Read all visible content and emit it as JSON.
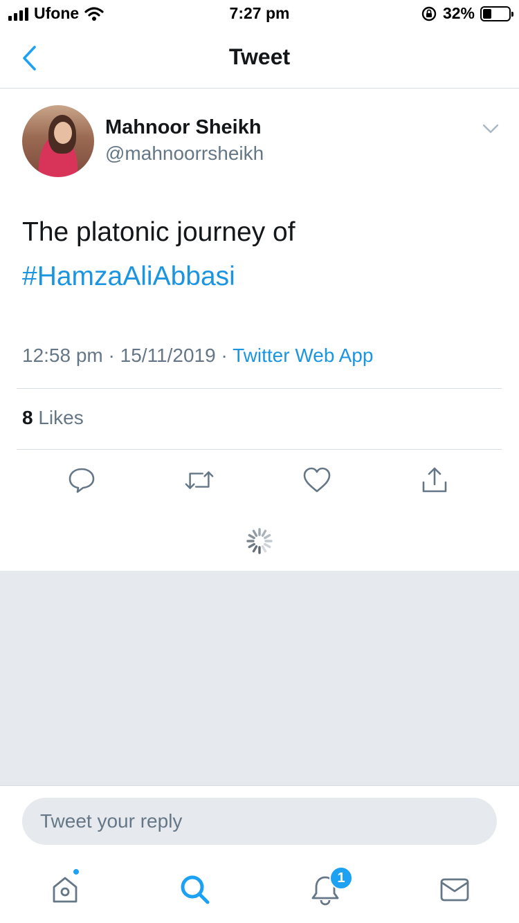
{
  "status_bar": {
    "carrier": "Ufone",
    "time": "7:27 pm",
    "battery_percent": "32%",
    "battery_level": 0.32,
    "icons": [
      "signal-icon",
      "wifi-icon",
      "orientation-lock-icon",
      "battery-icon"
    ]
  },
  "nav": {
    "title": "Tweet",
    "back_icon": "chevron-left-icon"
  },
  "tweet": {
    "author_name": "Mahnoor Sheikh",
    "author_handle": "@mahnoorrsheikh",
    "text": "The platonic journey of",
    "hashtag": "#HamzaAliAbbasi",
    "time": "12:58 pm",
    "date": "15/11/2019",
    "separator": "·",
    "source": "Twitter Web App",
    "likes_count": "8",
    "likes_label": "Likes"
  },
  "actions": [
    "reply-icon",
    "retweet-icon",
    "like-icon",
    "share-icon"
  ],
  "reply": {
    "placeholder": "Tweet your reply"
  },
  "tab_bar": {
    "tabs": [
      "home-icon",
      "search-icon",
      "notifications-icon",
      "messages-icon"
    ],
    "notifications_badge": "1"
  },
  "colors": {
    "accent": "#1da1f2",
    "link": "#1b95e0",
    "secondary_text": "#657786",
    "gray_background": "#e6e9ed"
  }
}
